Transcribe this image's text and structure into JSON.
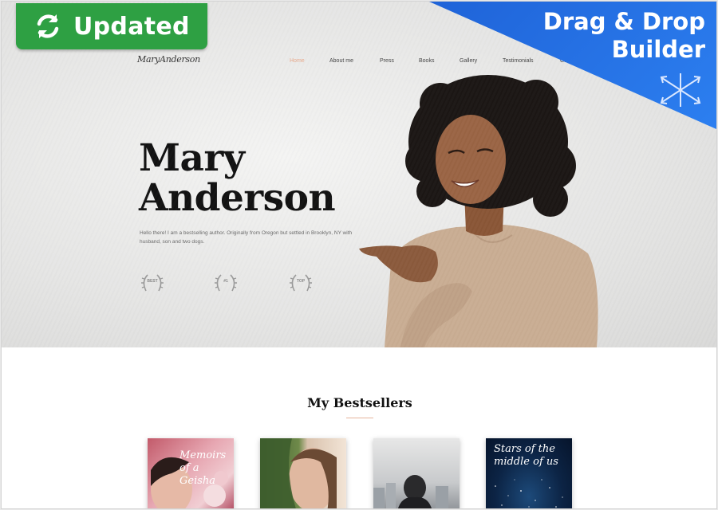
{
  "badges": {
    "updated_label": "Updated",
    "builder_line1": "Drag & Drop",
    "builder_line2": "Builder",
    "updated_color": "#2ea043",
    "builder_color": "#2478ea"
  },
  "site": {
    "logo": "MaryAnderson"
  },
  "nav": {
    "items": [
      "Home",
      "About me",
      "Press",
      "Books",
      "Gallery",
      "Testimonials",
      "Contacts"
    ],
    "active_index": 0,
    "active_color": "#e8a98c"
  },
  "hero": {
    "title_line1": "Mary",
    "title_line2": "Anderson",
    "text": "Hello there! I am a bestselling author. Originally from Oregon but settled in Brooklyn, NY with husband, son and two dogs.",
    "awards": [
      {
        "label": "BEST",
        "icon": "laurel-wreath-icon"
      },
      {
        "label": "#1",
        "icon": "laurel-wreath-icon"
      },
      {
        "label": "TOP",
        "icon": "laurel-wreath-icon"
      }
    ]
  },
  "bestsellers": {
    "title": "My Bestsellers",
    "books": [
      {
        "title": "Memoirs of a Geisha"
      },
      {
        "title": ""
      },
      {
        "title": ""
      },
      {
        "title": "Stars of the middle of us"
      }
    ]
  }
}
